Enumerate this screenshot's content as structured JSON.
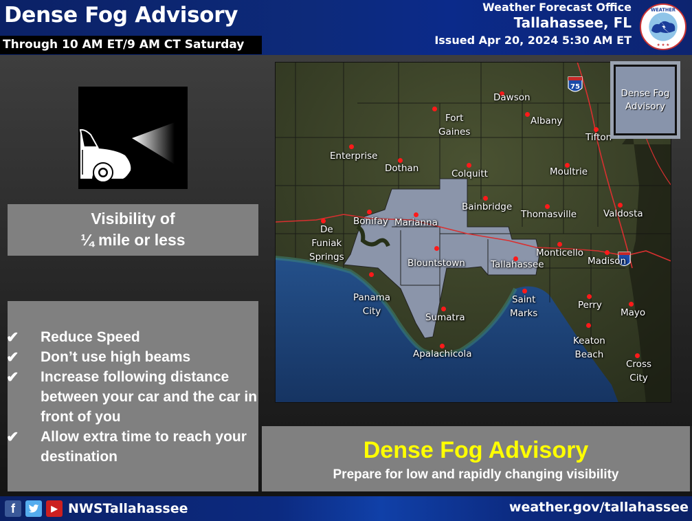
{
  "header": {
    "title": "Dense Fog Advisory",
    "subtitle": "Through 10 AM ET/9 AM CT Saturday",
    "office_label": "Weather Forecast Office",
    "office_location": "Tallahassee, FL",
    "issued": "Issued Apr 20,  2024 5:30 AM ET",
    "logo": "nws-logo-icon"
  },
  "visibility": {
    "icon": "car-headlight-fog-icon",
    "line1": "Visibility of",
    "line2": "¼ mile or less"
  },
  "tips": [
    {
      "check": "✔",
      "text": "Reduce Speed"
    },
    {
      "check": "✔",
      "text": "Don’t use high beams"
    },
    {
      "check": "✔",
      "text": "Increase following distance between your car and the car in front of you"
    },
    {
      "check": "✔",
      "text": "Allow extra time to reach your destination"
    }
  ],
  "map": {
    "legend": "Dense Fog Advisory",
    "interstate": "75",
    "colors": {
      "advisory": "#8b95aa",
      "land": "#3a4028",
      "water": "#1c3f73",
      "city_dot": "#ff1a1a",
      "road": "#d93030"
    },
    "cities": [
      {
        "name": "Dawson",
        "lines": [
          "Dawson"
        ]
      },
      {
        "name": "Fort Gaines",
        "lines": [
          "Fort",
          "Gaines"
        ]
      },
      {
        "name": "Albany",
        "lines": [
          "Albany"
        ]
      },
      {
        "name": "Tifton",
        "lines": [
          "Tifton"
        ]
      },
      {
        "name": "Enterprise",
        "lines": [
          "Enterprise"
        ]
      },
      {
        "name": "Dothan",
        "lines": [
          "Dothan"
        ]
      },
      {
        "name": "Colquitt",
        "lines": [
          "Colquitt"
        ]
      },
      {
        "name": "Moultrie",
        "lines": [
          "Moultrie"
        ]
      },
      {
        "name": "Bainbridge",
        "lines": [
          "Bainbridge"
        ]
      },
      {
        "name": "Thomasville",
        "lines": [
          "Thomasville"
        ]
      },
      {
        "name": "Valdosta",
        "lines": [
          "Valdosta"
        ]
      },
      {
        "name": "Bonifay",
        "lines": [
          "Bonifay"
        ]
      },
      {
        "name": "Marianna",
        "lines": [
          "Marianna"
        ]
      },
      {
        "name": "De Funiak Springs",
        "lines": [
          "De",
          "Funiak",
          "Springs"
        ]
      },
      {
        "name": "Blountstown",
        "lines": [
          "Blountstown"
        ]
      },
      {
        "name": "Monticello",
        "lines": [
          "Monticello"
        ]
      },
      {
        "name": "Tallahassee",
        "lines": [
          "Tallahassee"
        ]
      },
      {
        "name": "Madison",
        "lines": [
          "Madison"
        ]
      },
      {
        "name": "Panama City",
        "lines": [
          "Panama",
          "City"
        ]
      },
      {
        "name": "Saint Marks",
        "lines": [
          "Saint",
          "Marks"
        ]
      },
      {
        "name": "Perry",
        "lines": [
          "Perry"
        ]
      },
      {
        "name": "Mayo",
        "lines": [
          "Mayo"
        ]
      },
      {
        "name": "Sumatra",
        "lines": [
          "Sumatra"
        ]
      },
      {
        "name": "Keaton Beach",
        "lines": [
          "Keaton",
          "Beach"
        ]
      },
      {
        "name": "Apalachicola",
        "lines": [
          "Apalachicola"
        ]
      },
      {
        "name": "Cross City",
        "lines": [
          "Cross",
          "City"
        ]
      }
    ]
  },
  "banner": {
    "title": "Dense Fog Advisory",
    "subtitle": "Prepare for low and rapidly changing visibility"
  },
  "footer": {
    "social": [
      {
        "name": "facebook-icon",
        "glyph": "f"
      },
      {
        "name": "twitter-icon",
        "glyph": "🐦"
      },
      {
        "name": "youtube-icon",
        "glyph": "▶"
      }
    ],
    "handle": "NWSTallahassee",
    "url": "weather.gov/tallahassee"
  }
}
